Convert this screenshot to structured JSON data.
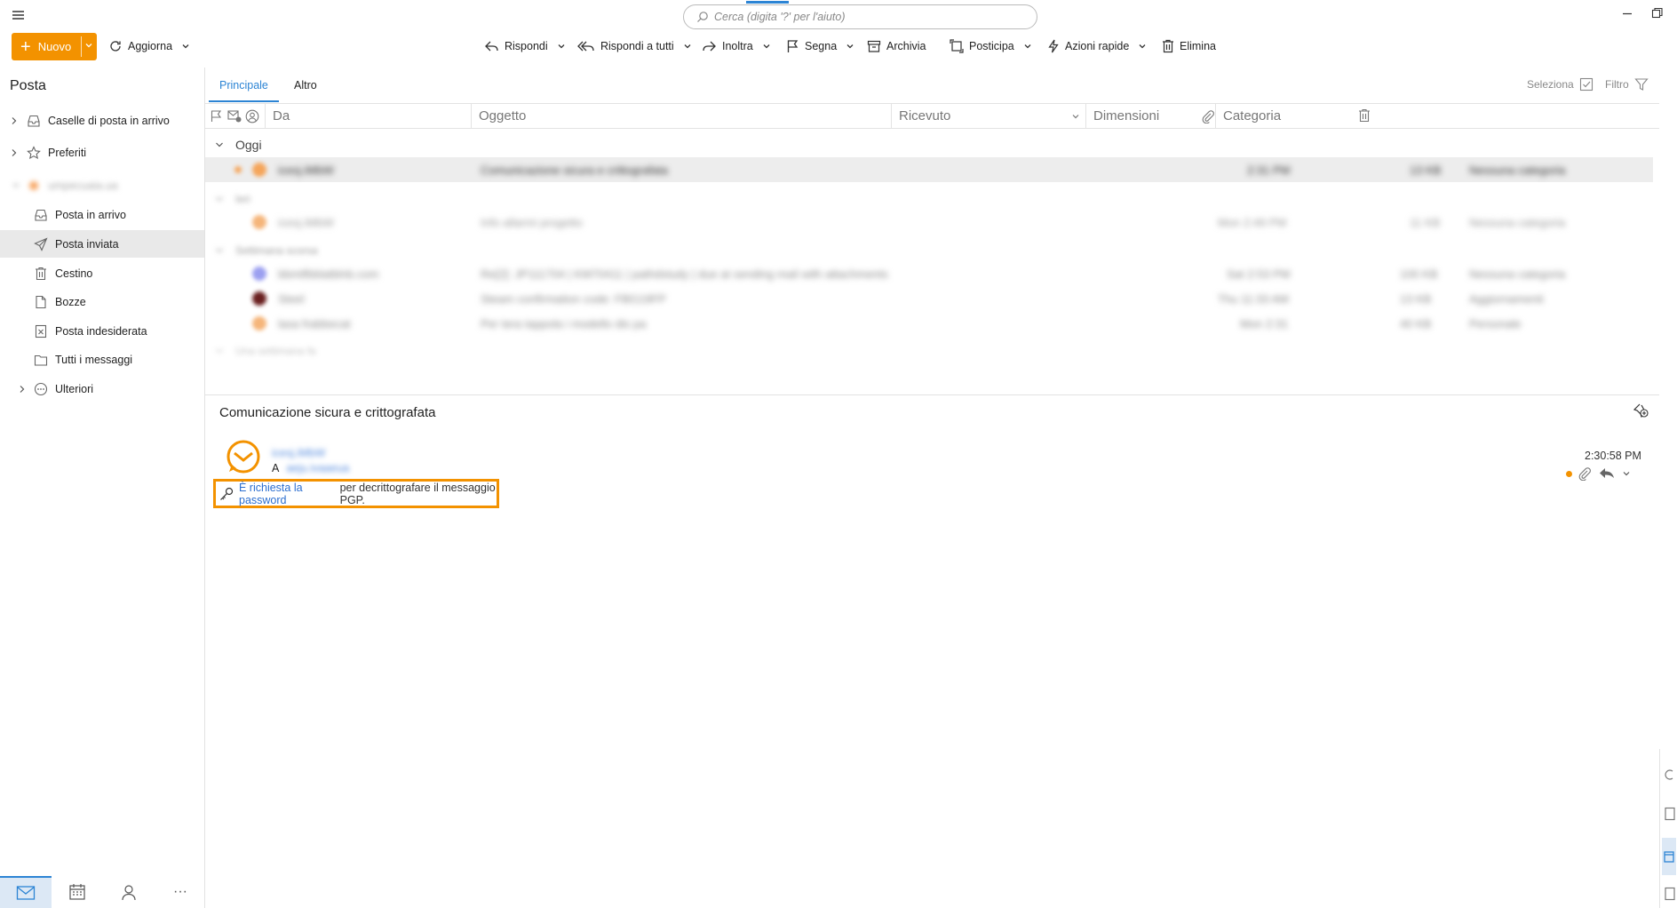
{
  "search": {
    "placeholder": "Cerca (digita '?' per l'aiuto)"
  },
  "toolbar": {
    "new_label": "Nuovo",
    "refresh_label": "Aggiorna",
    "reply_label": "Rispondi",
    "reply_all_label": "Rispondi a tutti",
    "forward_label": "Inoltra",
    "mark_label": "Segna",
    "archive_label": "Archivia",
    "snooze_label": "Posticipa",
    "quick_actions_label": "Azioni rapide",
    "delete_label": "Elimina"
  },
  "nav": {
    "title": "Posta",
    "items": [
      {
        "label": "Caselle di posta in arrivo"
      },
      {
        "label": "Preferiti"
      },
      {
        "label": "umpecuaia.ua"
      },
      {
        "label": "Posta in arrivo"
      },
      {
        "label": "Posta inviata"
      },
      {
        "label": "Cestino"
      },
      {
        "label": "Bozze"
      },
      {
        "label": "Posta indesiderata"
      },
      {
        "label": "Tutti i messaggi"
      },
      {
        "label": "Ulteriori"
      }
    ],
    "bottom": [
      "mail-icon",
      "calendar-icon",
      "contacts-icon",
      "more-icon"
    ],
    "more_glyph": "···"
  },
  "tabs": {
    "primary": "Principale",
    "other": "Altro",
    "select": "Seleziona",
    "filter": "Filtro"
  },
  "columns": {
    "from": "Da",
    "subject": "Oggetto",
    "received": "Ricevuto",
    "size": "Dimensioni",
    "category": "Categoria"
  },
  "groups": {
    "today": "Oggi",
    "g2": "Ieri",
    "g3": "Settimana scorsa",
    "g4": "Una settimana fa"
  },
  "messages": [
    {
      "from": "icesj.iMbW",
      "subject": "Comunicazione sicura e crittografata",
      "received": "2:31 PM",
      "size": "13 KB",
      "category": "Nessuna categoria",
      "avatar": "#f5a55a"
    },
    {
      "from": "icesj.iMbW",
      "subject": "Info allarmi progetto",
      "received": "Mon 2:49 PM",
      "size": "11 KB",
      "category": "Nessuna categoria",
      "avatar": "#f5b57a"
    },
    {
      "from": "bbmtfbblatblnb.com",
      "subject": "Re[2]: JP111704 | KM70411 | pathdstudy | due at sending mail with attachments",
      "received": "Sat 2:53 PM",
      "size": "100 KB",
      "category": "Nessuna categoria",
      "avatar": "#9b9ff0"
    },
    {
      "from": "Steel",
      "subject": "Steam confirmation code: FBG19FP",
      "received": "Thu 11:33 AM",
      "size": "13 KB",
      "category": "Aggiornamenti",
      "avatar": "#6a2020"
    },
    {
      "from": "lasa frabbecat",
      "subject": "Per tera tappola i modello dis pa",
      "received": "Mon 2:31",
      "size": "40 KB",
      "category": "Personale",
      "avatar": "#f5b57a"
    }
  ],
  "reading": {
    "subject": "Comunicazione sicura e crittografata",
    "sender": "icesj.iMbW",
    "to_label": "A",
    "to_address": "aeju.ivaaeua",
    "time": "2:30:58 PM",
    "pgp_link": "È richiesta la password",
    "pgp_text": "per decrittografare il messaggio PGP."
  },
  "colors": {
    "accent": "#f39200",
    "link": "#2c84d4"
  }
}
